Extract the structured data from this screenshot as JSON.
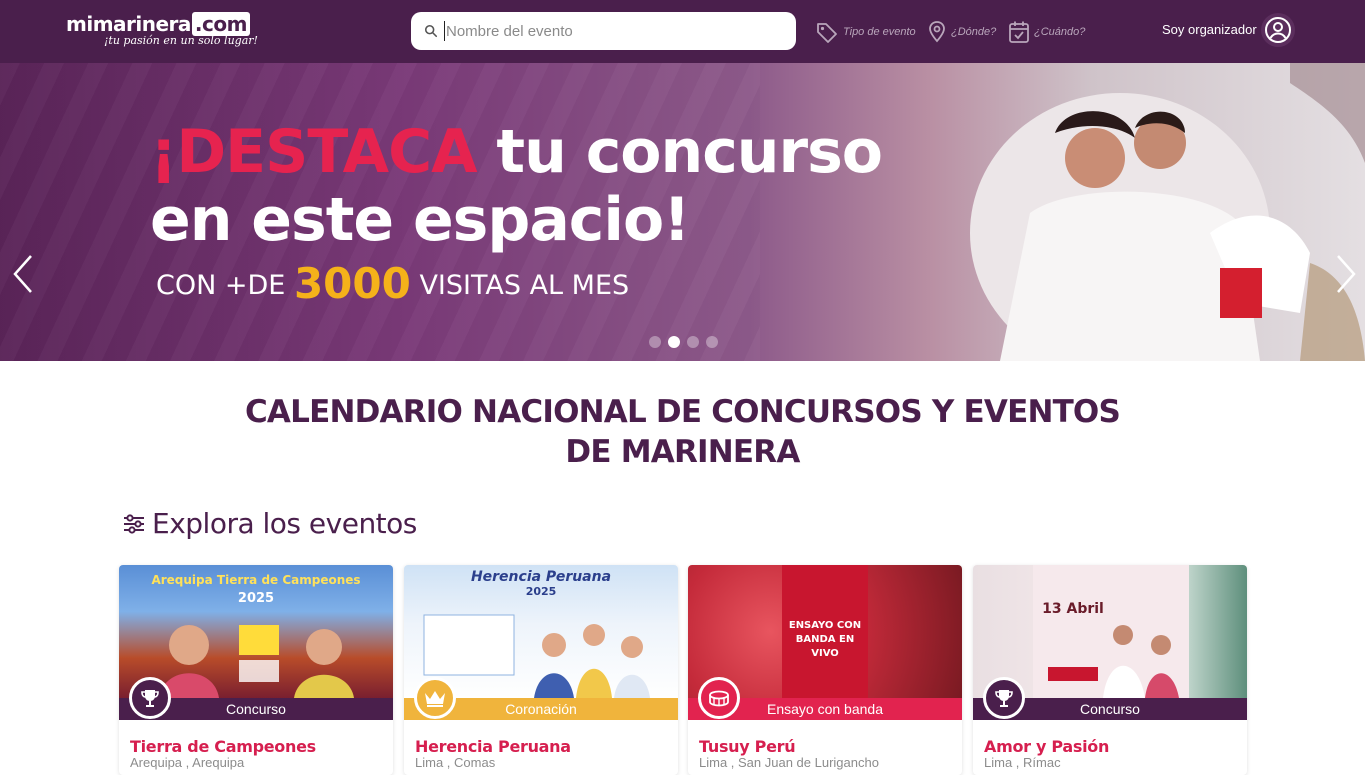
{
  "header": {
    "logo_main": "mimarinera",
    "logo_com": ".com",
    "logo_tagline": "¡tu pasión en un solo lugar!",
    "search_placeholder": "Nombre del evento",
    "filters": {
      "tipo": "Tipo de evento",
      "donde": "¿Dónde?",
      "cuando": "¿Cuándo?"
    },
    "organizer_label": "Soy organizador"
  },
  "banner": {
    "highlight": "¡DESTACA",
    "line1_rest": " tu concurso",
    "line2": "en este espacio!",
    "line3_pre": "CON +DE ",
    "line3_number": "3000",
    "line3_post": " VISITAS AL MES",
    "slide_count": 4,
    "active_slide": 2
  },
  "main": {
    "title_line1": "CALENDARIO NACIONAL DE CONCURSOS Y EVENTOS",
    "title_line2": "DE MARINERA",
    "section_title": "Explora los eventos"
  },
  "events": [
    {
      "category": "Concurso",
      "title": "Tierra de Campeones",
      "location": "Arequipa , Arequipa",
      "category_color": "#4a1f4c",
      "icon": "trophy-icon",
      "poster_heading": "Arequipa Tierra de Campeones",
      "poster_year": "2025"
    },
    {
      "category": "Coronación",
      "title": "Herencia Peruana",
      "location": "Lima , Comas",
      "category_color": "#f0b43c",
      "icon": "crown-icon",
      "poster_heading": "Herencia Peruana",
      "poster_year": "2025"
    },
    {
      "category": "Ensayo con banda",
      "title": "Tusuy Perú",
      "location": "Lima , San Juan de Lurigancho",
      "category_color": "#e2234f",
      "icon": "drum-icon",
      "poster_heading": "ENSAYO CON BANDA EN VIVO",
      "poster_year": ""
    },
    {
      "category": "Concurso",
      "title": "Amor y Pasión",
      "location": "Lima , Rímac",
      "category_color": "#4a1f4c",
      "icon": "trophy-icon",
      "poster_heading": "13 Abril",
      "poster_year": ""
    }
  ]
}
